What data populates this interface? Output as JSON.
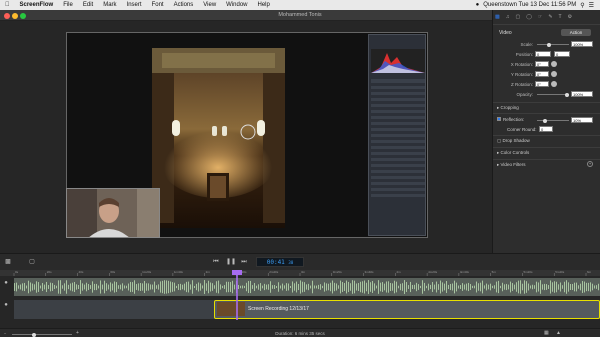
{
  "menubar": {
    "app_name": "ScreenFlow",
    "items": [
      "File",
      "Edit",
      "Mark",
      "Insert",
      "Font",
      "Actions",
      "View",
      "Window",
      "Help"
    ],
    "status_right": "Queenstown  Tue 13 Dec  11:56 PM"
  },
  "window": {
    "title": "Mohammed Tonis"
  },
  "inspector": {
    "section_title": "Video",
    "action_button": "Action",
    "scale_label": "Scale:",
    "scale_value": "100%",
    "position_label": "Position:",
    "position_x": "0",
    "position_y": "0",
    "xrot_label": "X Rotation:",
    "xrot_value": "0°",
    "yrot_label": "Y Rotation:",
    "yrot_value": "0°",
    "zrot_label": "Z Rotation:",
    "zrot_value": "0°",
    "opacity_label": "Opacity:",
    "opacity_value": "100%",
    "cropping_label": "Cropping",
    "reflection_label": "Reflection:",
    "reflection_value": "10%",
    "corner_label": "Corner Round:",
    "corner_value": "0",
    "dropshadow_label": "Drop Shadow",
    "colorcontrols_label": "Color Controls",
    "videofilters_label": "Video Filters"
  },
  "transport": {
    "timecode": "00:41",
    "timecode_frames": "30"
  },
  "timeline": {
    "clip_label": "Screen Recording 12/13/17",
    "ruler_ticks": [
      "0s",
      "20s",
      "40s",
      "60s",
      "1m20s",
      "1m40s",
      "2m",
      "2m20s",
      "2m40s",
      "3m",
      "3m20s",
      "3m40s",
      "4m",
      "4m20s",
      "4m40s",
      "5m",
      "5m20s",
      "5m40s",
      "6m"
    ]
  },
  "status": {
    "duration": "Duration: 6 mins 35 secs"
  },
  "colors": {
    "selection": "#e8e000",
    "playhead": "#a66cf0",
    "accent": "#2f7bf0"
  }
}
